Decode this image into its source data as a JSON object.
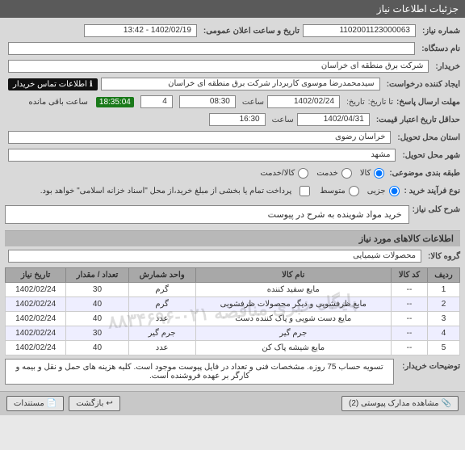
{
  "header": {
    "title": "جزئیات اطلاعات نیاز"
  },
  "labels": {
    "need_no": "شماره نیاز:",
    "device_name": "نام دستگاه:",
    "buyer": "خریدار:",
    "requester": "ایجاد کننده درخواست:",
    "contact": "اطلاعات تماس خریدار",
    "deadline": "مهلت ارسال پاسخ:",
    "from": "تا تاریخ:",
    "date": "تاریخ:",
    "time": "ساعت",
    "remaining": "ساعت باقی مانده",
    "announce": "تاریخ و ساعت اعلان عمومی:",
    "validity": "حداقل تاریخ اعتبار قیمت:",
    "province": "استان محل تحویل:",
    "city": "شهر محل تحویل:",
    "category": "طبقه بندی موضوعی:",
    "opt_kala": "کالا",
    "opt_service": "خدمت",
    "opt_both": "کالا/خدمت",
    "purchase_type": "نوع فرآیند خرید :",
    "opt_partial": "جزیی",
    "opt_medium": "متوسط",
    "pay_note": "پرداخت تمام یا بخشی از مبلغ خرید،از محل \"اسناد خزانه اسلامی\" خواهد بود.",
    "need_desc": "شرح کلی نیاز:",
    "goods_group": "گروه کالا:",
    "buyer_notes": "توضیحات خریدار:"
  },
  "fields": {
    "need_no": "1102001123000063",
    "device_name": "",
    "buyer": "شرکت برق منطقه ای خراسان",
    "requester": "سیدمحمدرضا موسوی کاربردار شرکت برق منطقه ای خراسان",
    "deadline_date": "1402/02/24",
    "deadline_time": "08:30",
    "days": "4",
    "remaining_time": "18:35:04",
    "validity_date": "1402/04/31",
    "validity_time": "16:30",
    "announce": "1402/02/19 - 13:42",
    "province": "خراسان رضوی",
    "city": "مشهد",
    "need_desc": "خرید مواد شوینده به شرح در پیوست",
    "goods_group": "محصولات شیمیایی",
    "buyer_notes": "تسویه حساب 75 روزه. مشخصات فنی و تعداد در فایل پیوست موجود است. کلیه هزینه های حمل و نقل و بیمه و کارگر بر عهده فروشنده است."
  },
  "section": {
    "items": "اطلاعات کالاهای مورد نیاز"
  },
  "watermark": "پایگاه خبری مناقصه ۰۲۱-۸۸۳۴۶۹۶",
  "table": {
    "headers": [
      "ردیف",
      "کد کالا",
      "نام کالا",
      "واحد شمارش",
      "تعداد / مقدار",
      "تاریخ نیاز"
    ],
    "rows": [
      [
        "1",
        "--",
        "مایع سفید کننده",
        "گرم",
        "30",
        "1402/02/24"
      ],
      [
        "2",
        "--",
        "مایع ظرفشویی و دیگر محصولات ظرفشویی",
        "گرم",
        "40",
        "1402/02/24"
      ],
      [
        "3",
        "--",
        "مایع دست شویی و پاک کننده دست",
        "عدد",
        "40",
        "1402/02/24"
      ],
      [
        "4",
        "--",
        "جرم گیر",
        "جرم گیر",
        "30",
        "1402/02/24"
      ],
      [
        "5",
        "--",
        "مایع شیشه پاک کن",
        "عدد",
        "40",
        "1402/02/24"
      ]
    ]
  },
  "footer": {
    "view_attach": "مشاهده مدارک پیوستی (2)",
    "back": "بازگشت",
    "docs": "مستندات"
  },
  "icons": {
    "info": "ℹ",
    "attach": "📎",
    "back": "↩",
    "doc": "📄"
  }
}
